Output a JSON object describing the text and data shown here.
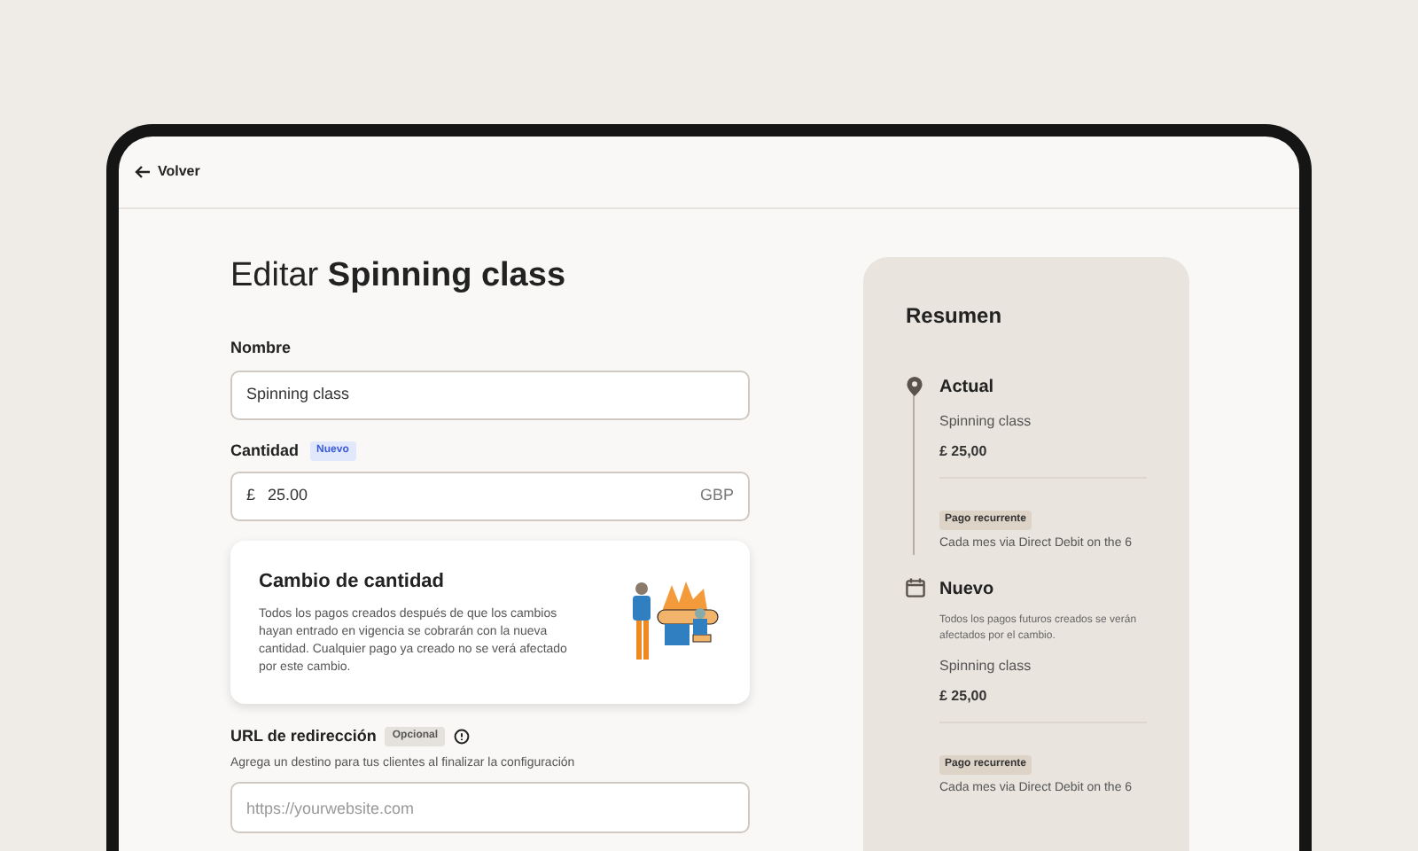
{
  "header": {
    "back_label": "Volver"
  },
  "title": "Editar **Spinning class**",
  "fields": [
    {
      "kind": "text",
      "label": "Nombre",
      "value": "Spinning class"
    },
    {
      "kind": "amount",
      "label": "Cantidad",
      "badge": "Nuevo",
      "prefix": "£",
      "value": "25.00",
      "suffix": "GBP"
    }
  ],
  "notice": {
    "title": "Cambio de cantidad",
    "body": "Todos los pagos creados después de que los cambios hayan entrado en vigencia se cobrarán con la nueva cantidad. Cualquier pago ya creado no se verá afectado por este cambio."
  },
  "redirect": {
    "label": "URL de redirección",
    "badge": "Opcional",
    "hint": "Agrega un destino para tus clientes al finalizar la configuración",
    "placeholder": "https://yourwebsite.com"
  },
  "summary": {
    "title": "Resumen",
    "steps": [
      {
        "kind": "current",
        "title": "Actual",
        "name": "Spinning class",
        "amount": "£ 25,00",
        "tag": "Pago recurrente",
        "schedule": "Cada mes via Direct Debit on the 6"
      },
      {
        "kind": "new",
        "title": "Nuevo",
        "note": "Todos los pagos futuros creados se verán afectados por el cambio.",
        "name": "Spinning class",
        "amount": "£ 25,00",
        "tag": "Pago recurrente",
        "schedule": "Cada mes via Direct Debit on the 6"
      }
    ]
  }
}
